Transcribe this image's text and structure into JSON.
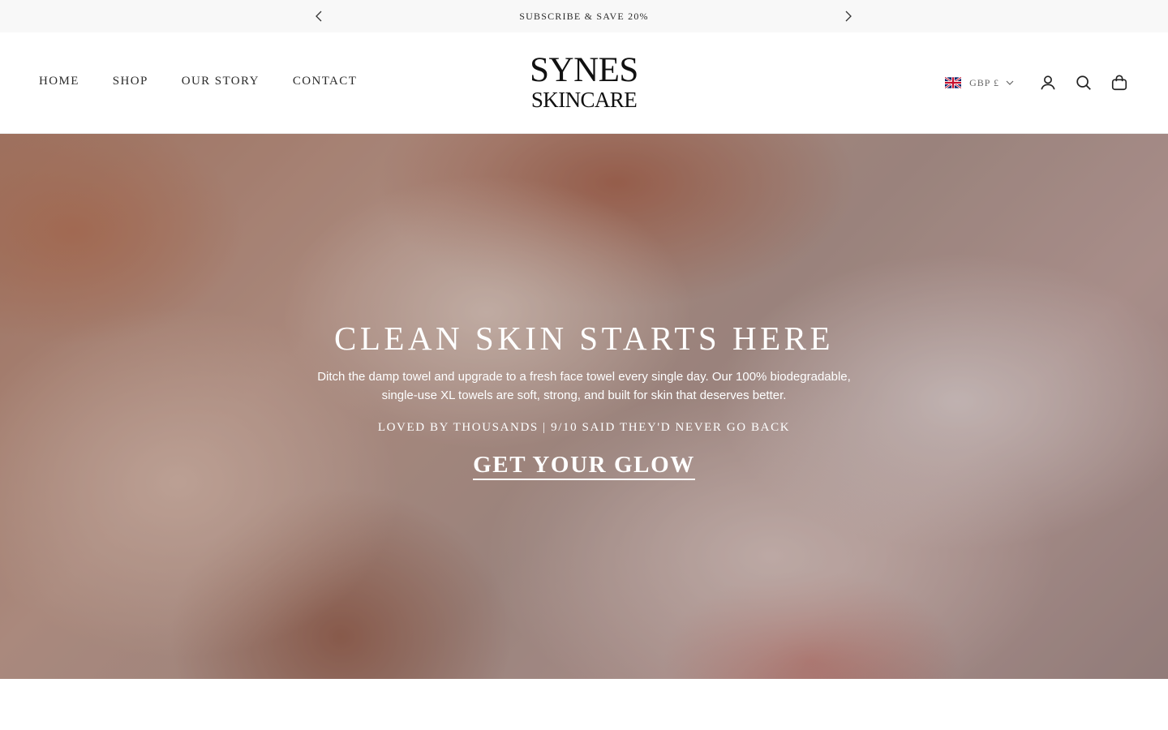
{
  "announcement": {
    "text": "SUBSCRIBE & SAVE 20%",
    "prev_icon": "chevron-left-icon",
    "next_icon": "chevron-right-icon"
  },
  "header": {
    "nav": [
      {
        "label": "HOME"
      },
      {
        "label": "SHOP"
      },
      {
        "label": "OUR STORY"
      },
      {
        "label": "CONTACT"
      }
    ],
    "logo": {
      "line1": "SYNES",
      "line2": "SKINCARE"
    },
    "currency": {
      "label": "GBP £",
      "flag": "uk-flag-icon"
    },
    "icons": [
      "account-icon",
      "search-icon",
      "cart-icon"
    ]
  },
  "hero": {
    "title": "CLEAN SKIN STARTS HERE",
    "description": "Ditch the damp towel and upgrade to a fresh face towel every single day. Our 100% biodegradable, single-use XL towels are soft, strong, and built for skin that deserves better.",
    "tagline": "LOVED BY THOUSANDS | 9/10 SAID THEY'D NEVER GO BACK",
    "cta": "GET YOUR GLOW"
  },
  "colors": {
    "announcement_bg": "#f8f8f8",
    "text_dark": "#2b2b2b",
    "hero_text": "#ffffff"
  }
}
